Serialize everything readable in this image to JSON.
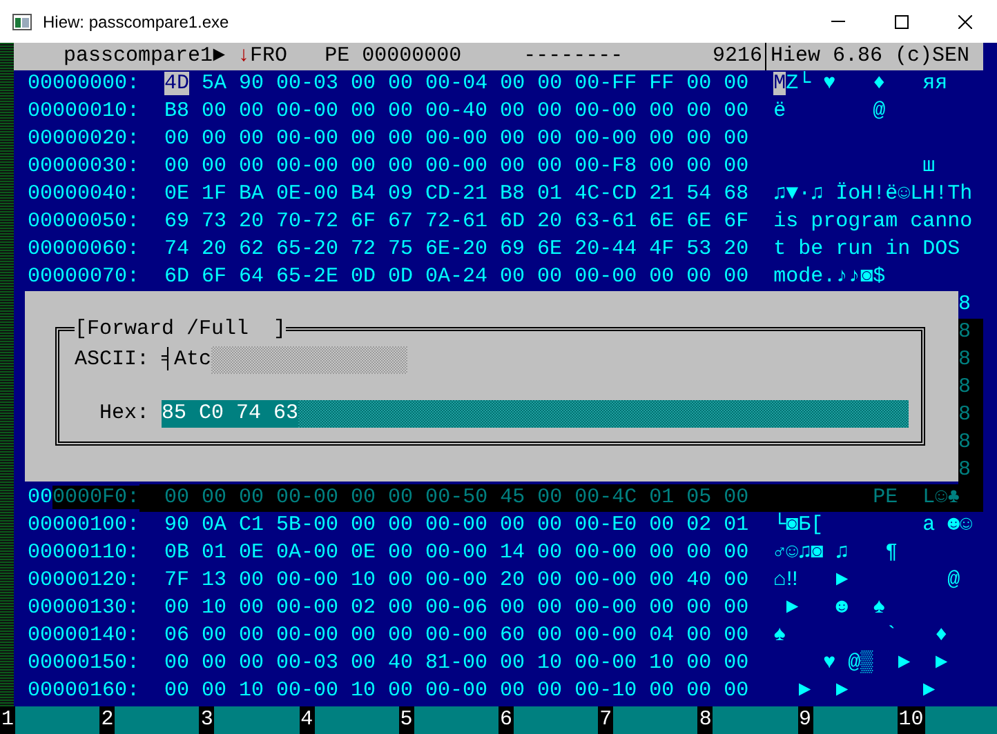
{
  "window": {
    "title": "Hiew: passcompare1.exe"
  },
  "header": {
    "file": "passcompare1►",
    "mode": "↓FRO",
    "offset": "PE 00000000",
    "flags": "--------",
    "size": "9216",
    "version": "Hiew 6.86 (c)SEN"
  },
  "rows": [
    {
      "address": "00000000:",
      "hex": "4D 5A 90 00-03 00 00 00-04 00 00 00-FF FF 00 00",
      "text": "MZ└ ♥   ♦   яя",
      "cursor": true
    },
    {
      "address": "00000010:",
      "hex": "B8 00 00 00-00 00 00 00-40 00 00 00-00 00 00 00",
      "text": "ё       @",
      "cursor": false
    },
    {
      "address": "00000020:",
      "hex": "00 00 00 00-00 00 00 00-00 00 00 00-00 00 00 00",
      "text": "",
      "cursor": false
    },
    {
      "address": "00000030:",
      "hex": "00 00 00 00-00 00 00 00-00 00 00 00-F8 00 00 00",
      "text": "            ш",
      "cursor": false
    },
    {
      "address": "00000040:",
      "hex": "0E 1F BA 0E-00 B4 09 CD-21 B8 01 4C-CD 21 54 68",
      "text": "♫▼·♫ ÏoH!ë☺LH!Th",
      "cursor": false
    },
    {
      "address": "00000050:",
      "hex": "69 73 20 70-72 6F 67 72-61 6D 20 63-61 6E 6E 6F",
      "text": "is program canno",
      "cursor": false
    },
    {
      "address": "00000060:",
      "hex": "74 20 62 65-20 72 75 6E-20 69 6E 20-44 4F 53 20",
      "text": "t be run in DOS",
      "cursor": false
    },
    {
      "address": "00000070:",
      "hex": "6D 6F 64 65-2E 0D 0D 0A-24 00 00 00-00 00 00 00",
      "text": "mode.♪♪◙$",
      "cursor": false
    }
  ],
  "search_dialog": {
    "title": "[Forward /Full  ]",
    "ascii_label": "ASCII:",
    "ascii_value": "╡Atc",
    "hex_label": "Hex:",
    "hex_value": "85 C0 74 63"
  },
  "covered_row_ends": [
    {
      "char": "8",
      "shadowed": false
    },
    {
      "char": "8",
      "shadowed": true
    },
    {
      "char": "8",
      "shadowed": true
    },
    {
      "char": "8",
      "shadowed": true
    },
    {
      "char": "8",
      "shadowed": true
    },
    {
      "char": "8",
      "shadowed": true
    },
    {
      "char": "8",
      "shadowed": true
    }
  ],
  "rows_below": [
    {
      "address": "000000F0:",
      "hex": "00 00 00 00-00 00 00 00-50 45 00 00-4C 01 05 00",
      "text": "        PE  L☺♣",
      "shadowed": true
    },
    {
      "address": "00000100:",
      "hex": "90 0A C1 5B-00 00 00 00-00 00 00 00-E0 00 02 01",
      "text": "└◙Б[        а ☻☺",
      "shadowed": false
    },
    {
      "address": "00000110:",
      "hex": "0B 01 0E 0A-00 0E 00 00-00 14 00 00-00 00 00 00",
      "text": "♂☺♫◙ ♫   ¶",
      "shadowed": false
    },
    {
      "address": "00000120:",
      "hex": "7F 13 00 00-00 10 00 00-00 20 00 00-00 00 40 00",
      "text": "⌂‼   ►        @",
      "shadowed": false
    },
    {
      "address": "00000130:",
      "hex": "00 10 00 00-00 02 00 00-06 00 00 00-00 00 00 00",
      "text": " ►   ☻  ♠",
      "shadowed": false
    },
    {
      "address": "00000140:",
      "hex": "06 00 00 00-00 00 00 00-00 60 00 00-00 04 00 00",
      "text": "♠        `   ♦",
      "shadowed": false
    },
    {
      "address": "00000150:",
      "hex": "00 00 00 00-03 00 40 81-00 00 10 00-00 10 00 00",
      "text": "    ♥ @▒  ►  ►",
      "shadowed": false
    },
    {
      "address": "00000160:",
      "hex": "00 00 10 00-00 10 00 00-00 00 00 00-10 00 00 00",
      "text": "  ►  ►      ►",
      "shadowed": false
    }
  ],
  "function_keys": [
    "1",
    "2",
    "3",
    "4",
    "5",
    "6",
    "7",
    "8",
    "9",
    "10"
  ]
}
